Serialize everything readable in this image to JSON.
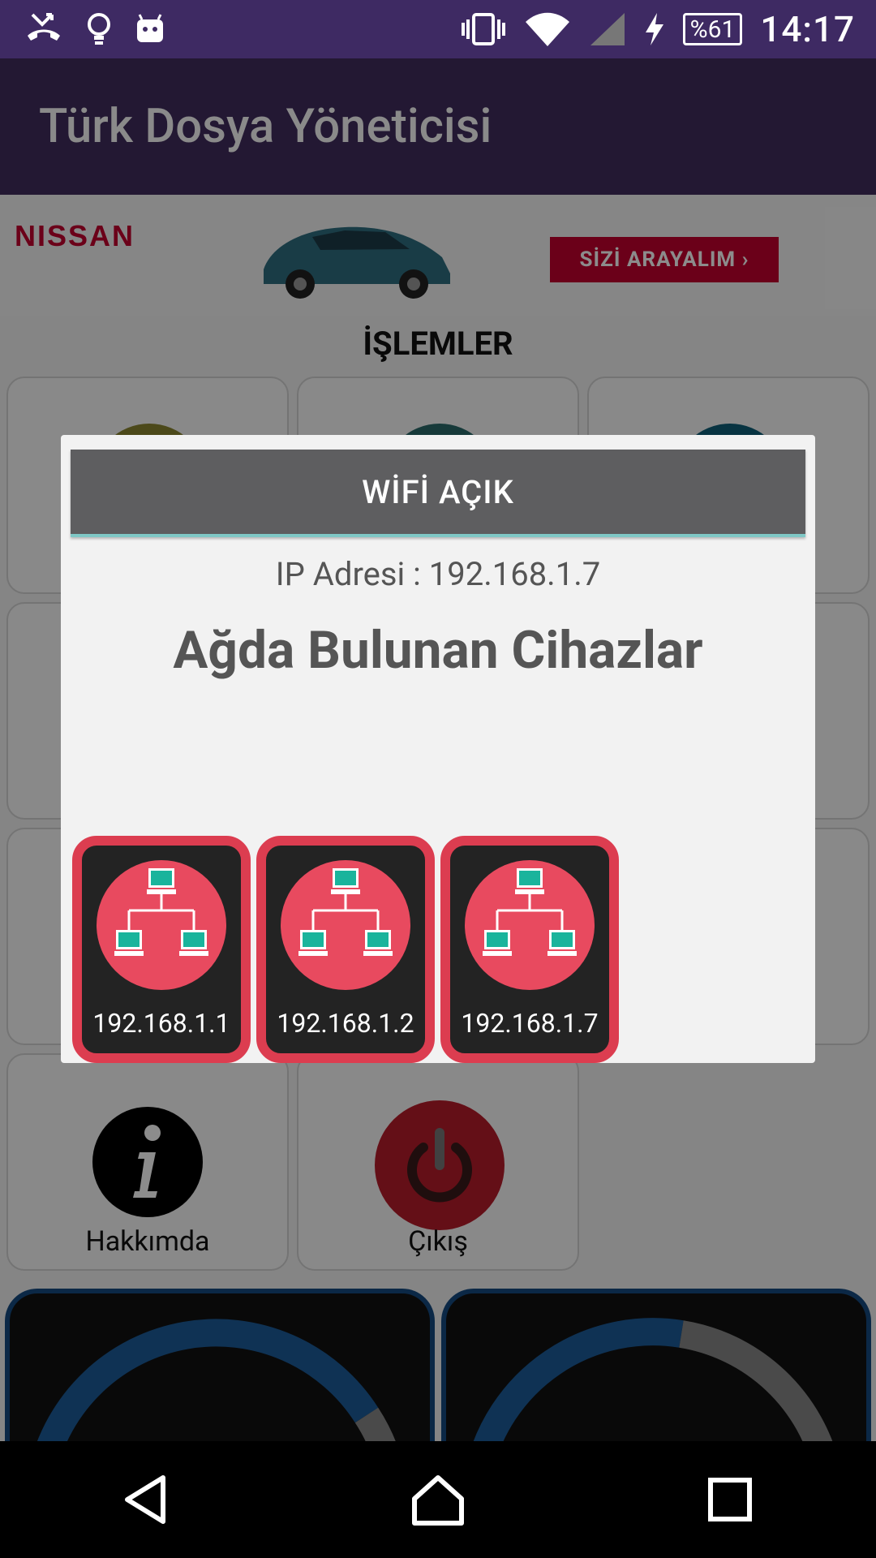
{
  "status_bar": {
    "battery": "%61",
    "time": "14:17",
    "icons": [
      "missed-call-icon",
      "lightbulb-icon",
      "android-icon",
      "vibrate-icon",
      "wifi-icon",
      "cell-signal-icon",
      "charging-icon",
      "battery-icon"
    ]
  },
  "app": {
    "title": "Türk Dosya Yöneticisi"
  },
  "ad": {
    "brand": "NISSAN",
    "cta": "SİZİ ARAYALIM ›"
  },
  "main": {
    "section_title": "İŞLEMLER",
    "tiles": [
      {
        "label": "Hakkımda",
        "icon": "info-icon"
      },
      {
        "label": "Çıkış",
        "icon": "power-icon"
      }
    ]
  },
  "dialog": {
    "header": "WİFİ AÇIK",
    "ip_text": "IP Adresi : 192.168.1.7",
    "subtitle": "Ağda Bulunan Cihazlar",
    "devices": [
      {
        "ip": "192.168.1.1",
        "icon": "network-icon"
      },
      {
        "ip": "192.168.1.2",
        "icon": "network-icon"
      },
      {
        "ip": "192.168.1.7",
        "icon": "network-icon"
      }
    ]
  },
  "colors": {
    "status_bar": "#3e2a63",
    "app_bar": "#231833",
    "dialog_header": "#5e5e60",
    "device_border": "#dc3d50",
    "device_circle": "#e84a5f",
    "computer_screen": "#1ab49c"
  },
  "nav": {
    "buttons": [
      "back-icon",
      "home-icon",
      "recents-icon"
    ]
  }
}
